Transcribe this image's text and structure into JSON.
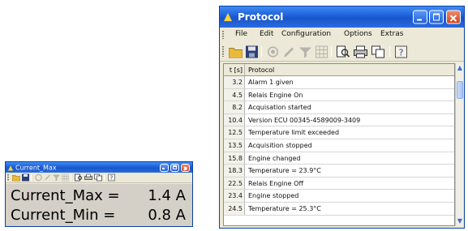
{
  "current_window": {
    "title": "Current_Max",
    "toolbar_icons": [
      "open-folder-icon",
      "save-disk-icon",
      "record-icon",
      "edit-icon",
      "filter-icon",
      "table-icon",
      "print-preview-icon",
      "print-icon",
      "copy-icon",
      "help-icon"
    ],
    "rows": [
      {
        "label": "Current_Max =",
        "value": "1.4 A"
      },
      {
        "label": "Current_Min =",
        "value": "0.8 A"
      }
    ]
  },
  "protocol_window": {
    "title": "Protocol",
    "menu": [
      "File",
      "Edit",
      "Configuration",
      "Options",
      "Extras"
    ],
    "toolbar_icons": [
      "open-folder-icon",
      "save-disk-icon",
      "record-icon",
      "edit-icon",
      "filter-icon",
      "table-icon",
      "print-preview-icon",
      "print-icon",
      "copy-icon",
      "help-icon"
    ],
    "columns": [
      "t [s]",
      "Protocol"
    ],
    "rows": [
      {
        "time": "3.2",
        "text": "Alarm 1 given"
      },
      {
        "time": "4.5",
        "text": "Relais Engine On"
      },
      {
        "time": "8.2",
        "text": "Acquisation started"
      },
      {
        "time": "10.4",
        "text": "Version ECU 00345-4589009-3409"
      },
      {
        "time": "12.5",
        "text": "Temperature limit exceeded"
      },
      {
        "time": "13.5",
        "text": "Acquisition stopped"
      },
      {
        "time": "15.8",
        "text": "Engine changed"
      },
      {
        "time": "18.3",
        "text": "Temperature = 23.9°C"
      },
      {
        "time": "22.5",
        "text": "Relais Engine Off"
      },
      {
        "time": "23.4",
        "text": "Engine stopped"
      },
      {
        "time": "24.5",
        "text": "Temperature = 25.3°C"
      }
    ]
  },
  "colors": {
    "titlebar": "#1d5fd9",
    "close_button": "#d2451e",
    "window_face": "#ece9d8",
    "value_area": "#d4d0c8"
  }
}
